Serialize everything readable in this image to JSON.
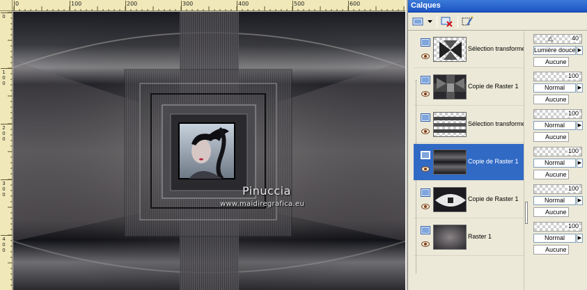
{
  "rulers": {
    "h_labels": [
      "0",
      "100",
      "200",
      "300",
      "400",
      "500",
      "600"
    ],
    "v_labels": [
      "0",
      "1\n0\n0",
      "2\n0\n0",
      "3\n0\n0",
      "4\n0\n0"
    ]
  },
  "canvas": {
    "signature": "Pinuccia",
    "url": "www.maidiregrafica.eu"
  },
  "panel": {
    "title": "Calques",
    "toolbar_icons": [
      "new-raster-layer-icon",
      "dropdown-arrow-icon",
      "delete-layer-icon",
      "layer-properties-icon"
    ]
  },
  "layers": [
    {
      "name": "Sélection transformée",
      "selected": false
    },
    {
      "name": "Copie de Raster 1",
      "selected": false
    },
    {
      "name": "Sélection transformée",
      "selected": false
    },
    {
      "name": "Copie de Raster 1",
      "selected": true
    },
    {
      "name": "Copie de Raster 1",
      "selected": false
    },
    {
      "name": "Raster 1",
      "selected": false
    }
  ],
  "layer_props": [
    {
      "opacity": "40",
      "blend": "Lumière douce",
      "mask": "Aucune"
    },
    {
      "opacity": "100",
      "blend": "Normal",
      "mask": "Aucune"
    },
    {
      "opacity": "100",
      "blend": "Normal",
      "mask": "Aucune"
    },
    {
      "opacity": "100",
      "blend": "Normal",
      "mask": "Aucune"
    },
    {
      "opacity": "100",
      "blend": "Normal",
      "mask": "Aucune"
    },
    {
      "opacity": "100",
      "blend": "Normal",
      "mask": "Aucune"
    }
  ],
  "colors": {
    "title_bar": "#2a63cc",
    "selected_row": "#316ac5",
    "panel_bg": "#ece9d8",
    "ruler_bg": "#f0e8b8"
  }
}
